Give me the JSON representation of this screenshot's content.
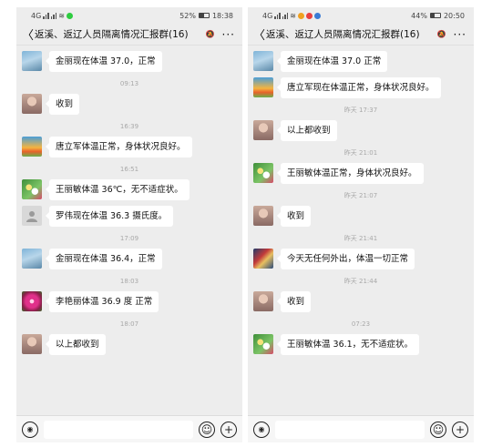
{
  "left": {
    "status": {
      "network": "4G",
      "wifi": "≋",
      "battery": "52%",
      "battery_fraction": 0.52,
      "time": "18:38",
      "app_dot_color": "#2ecc40"
    },
    "header": {
      "back": "〈",
      "title": "返溪、返辽人员隔离情况汇报群(16)",
      "more": "···"
    },
    "messages": [
      {
        "type": "msg",
        "avatar": "av-sky",
        "text": "金丽现在体温 37.0，正常"
      },
      {
        "type": "time",
        "text": "09:13"
      },
      {
        "type": "msg",
        "avatar": "av-girl",
        "text": "收到"
      },
      {
        "type": "time",
        "text": "16:39"
      },
      {
        "type": "msg",
        "avatar": "av-sun",
        "text": "唐立军体温正常，身体状况良好。"
      },
      {
        "type": "time",
        "text": "16:51"
      },
      {
        "type": "msg",
        "avatar": "av-flower",
        "text": "王丽敏体温 36℃，无不适症状。"
      },
      {
        "type": "msg",
        "avatar": "av-person",
        "text": "罗伟现在体温 36.3 摄氏度。"
      },
      {
        "type": "time",
        "text": "17:09"
      },
      {
        "type": "msg",
        "avatar": "av-sky",
        "text": "金丽现在体温 36.4，正常"
      },
      {
        "type": "time",
        "text": "18:03"
      },
      {
        "type": "msg",
        "avatar": "av-pink",
        "text": "李艳丽体温 36.9 度 正常"
      },
      {
        "type": "time",
        "text": "18:07"
      },
      {
        "type": "msg",
        "avatar": "av-girl",
        "text": "以上都收到"
      }
    ]
  },
  "right": {
    "status": {
      "network": "4G",
      "wifi": "≋",
      "battery": "44%",
      "battery_fraction": 0.44,
      "time": "20:50",
      "app_dot_color": "#e84040"
    },
    "header": {
      "back": "〈",
      "title": "返溪、返辽人员隔离情况汇报群(16)",
      "more": "···"
    },
    "messages": [
      {
        "type": "msg",
        "avatar": "av-sky",
        "text": "金丽现在体温 37.0 正常"
      },
      {
        "type": "msg",
        "avatar": "av-sun",
        "text": "唐立军现在体温正常，身体状况良好。"
      },
      {
        "type": "time",
        "text": "昨天 17:37"
      },
      {
        "type": "msg",
        "avatar": "av-girl",
        "text": "以上都收到"
      },
      {
        "type": "time",
        "text": "昨天 21:01"
      },
      {
        "type": "msg",
        "avatar": "av-flower",
        "text": "王丽敏体温正常，身体状况良好。"
      },
      {
        "type": "time",
        "text": "昨天 21:07"
      },
      {
        "type": "msg",
        "avatar": "av-girl",
        "text": "收到"
      },
      {
        "type": "time",
        "text": "昨天 21:41"
      },
      {
        "type": "msg",
        "avatar": "av-group",
        "text": "今天无任何外出，体温一切正常"
      },
      {
        "type": "time",
        "text": "昨天 21:44"
      },
      {
        "type": "msg",
        "avatar": "av-girl",
        "text": "收到"
      },
      {
        "type": "time",
        "text": "07:23"
      },
      {
        "type": "msg",
        "avatar": "av-flower",
        "text": "王丽敏体温 36.1，无不适症状。"
      }
    ]
  },
  "input_bar": {
    "voice_icon": "voice-icon",
    "emoji_icon": "emoji-icon",
    "add_icon": "add-icon"
  }
}
